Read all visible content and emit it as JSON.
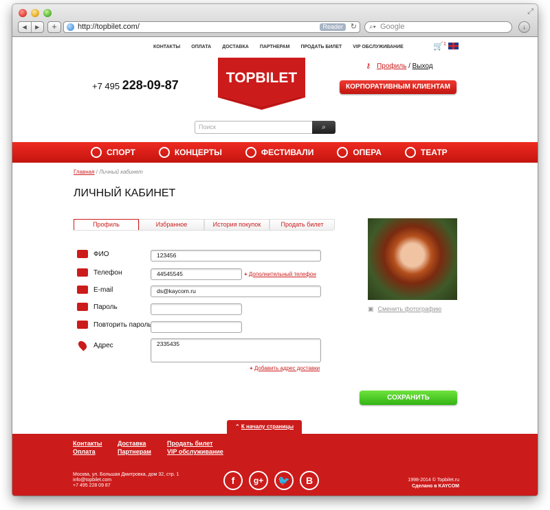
{
  "browser": {
    "url": "http://topbilet.com/",
    "reader": "Reader",
    "search_placeholder": "Google"
  },
  "header": {
    "top_nav": [
      "КОНТАКТЫ",
      "ОПЛАТА",
      "ДОСТАВКА",
      "ПАРТНЕРАМ",
      "ПРОДАТЬ БИЛЕТ",
      "VIP ОБСЛУЖИВАНИЕ"
    ],
    "cart_count": "1",
    "logo": "TOPBILET",
    "phone_prefix": "+7 495",
    "phone_number": "228-09-87",
    "profile_link": "Профиль",
    "separator": "/",
    "logout_link": "Выход",
    "corporate_button": "КОРПОРАТИВНЫМ КЛИЕНТАМ",
    "search_placeholder": "Поиск"
  },
  "categories": [
    "СПОРТ",
    "КОНЦЕРТЫ",
    "ФЕСТИВАЛИ",
    "ОПЕРА",
    "ТЕАТР"
  ],
  "breadcrumb": {
    "home": "Главная",
    "sep": "/",
    "current": "Личный кабинет"
  },
  "page_title": "ЛИЧНЫЙ КАБИНЕТ",
  "tabs": [
    "Профиль",
    "Избранное",
    "История покупок",
    "Продать билет"
  ],
  "form": {
    "name_label": "ФИО",
    "name_value": "123456",
    "phone_label": "Телефон",
    "phone_value": "44545545",
    "add_phone": "Дополнительный телефон",
    "email_label": "E-mail",
    "email_value": "ds@kaycom.ru",
    "password_label": "Пароль",
    "password_value": "",
    "repeat_label": "Повторить пароль",
    "repeat_value": "",
    "address_label": "Адрес",
    "address_value": "2335435",
    "add_address": "Добавить адрес доставки",
    "plus": "+"
  },
  "photo": {
    "change_label": "Сменить фотографию"
  },
  "save_button": "СОХРАНИТЬ",
  "to_top": "К началу страницы",
  "footer": {
    "col1": [
      "Контакты",
      "Оплата"
    ],
    "col2": [
      "Доставка",
      "Партнерам"
    ],
    "col3": [
      "Продать билет",
      "VIP обслуживание"
    ],
    "address": "Москва, ул. Большая Дмитровка, дом 32, стр. 1",
    "email": "info@topbilet.com",
    "phone": "+7 495 228 09 87",
    "social": [
      "f",
      "g+",
      "t",
      "B"
    ],
    "copyright": "1998-2014 © Topbilet.ru",
    "made_by": "Сделано в KAYCOM"
  },
  "colors": {
    "brand_red": "#cc1b1b",
    "save_green": "#33b314"
  }
}
